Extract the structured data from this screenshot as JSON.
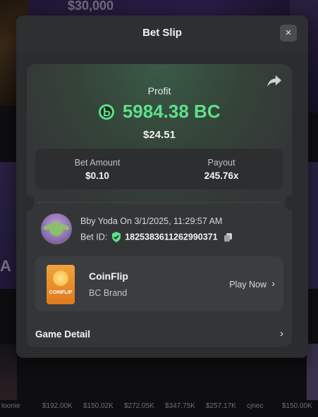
{
  "background": {
    "jackpot_text": "$30,000",
    "left_text": "A",
    "footer_values": [
      "loonie",
      "$192.00K",
      "$150.02K",
      "$272.05K",
      "$347.75K",
      "$257.17K",
      "cjnec",
      "$150.00K"
    ]
  },
  "modal": {
    "title": "Bet Slip",
    "close_icon": "close-icon",
    "close_label": "×"
  },
  "profit": {
    "label": "Profit",
    "value": "5984.38 BC",
    "usd": "$24.51",
    "currency_icon": "bc-coin-icon",
    "accent_color": "#5ee08a"
  },
  "stats": {
    "bet_amount_label": "Bet Amount",
    "bet_amount_value": "$0.10",
    "payout_label": "Payout",
    "payout_value": "245.76x"
  },
  "bettor": {
    "line": "Bby Yoda On 3/1/2025, 11:29:57 AM",
    "bet_id_label": "Bet ID:",
    "bet_id_value": "1825383611262990371"
  },
  "game": {
    "name": "CoinFlip",
    "brand": "BC Brand",
    "thumb_text": "COINFLIP",
    "play_now": "Play Now",
    "chevron": "›"
  },
  "game_detail": {
    "label": "Game Detail",
    "chevron": "›"
  }
}
